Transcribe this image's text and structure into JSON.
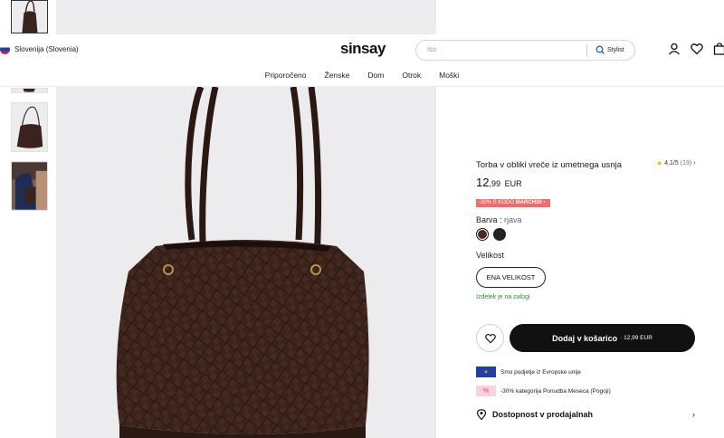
{
  "header": {
    "country": "Slovenija (Slovenia)",
    "logo": "sinsay",
    "search_placeholder": "Išči",
    "stylist_label": "Stylist",
    "icons": [
      "user-icon",
      "heart-icon",
      "bag-icon"
    ]
  },
  "nav": [
    {
      "label": "Priporočeno"
    },
    {
      "label": "Ženske"
    },
    {
      "label": "Dom"
    },
    {
      "label": "Otrok"
    },
    {
      "label": "Moški"
    }
  ],
  "product": {
    "title": "Torba v obliki vreče iz umetnega usnja",
    "rating": "4,1/5",
    "reviews": "(19)",
    "price_int": "12",
    "price_dec": ",99",
    "currency": "EUR",
    "promo_prefix": "-30% S KODO",
    "promo_code": "MARCH30",
    "color_label": "Barva :",
    "color_value": "rjava",
    "size_label": "Velikost",
    "size_option": "ENA VELIKOST",
    "stock": "Izdelek je na zalogi",
    "add_label": "Dodaj v košarico",
    "add_price": "· 12,99 EUR",
    "feature_eu": "Smo podjetje iz Evropske unije",
    "feature_discount": "-30% kategorija Ponudba Meseca (Pogoji)",
    "availability": "Dostopnost v prodajalnah"
  },
  "colors": {
    "brand_black": "#111111",
    "promo": "#f26a6a",
    "stock_green": "#2e8a3e",
    "bag_brown": "#3b231d"
  }
}
